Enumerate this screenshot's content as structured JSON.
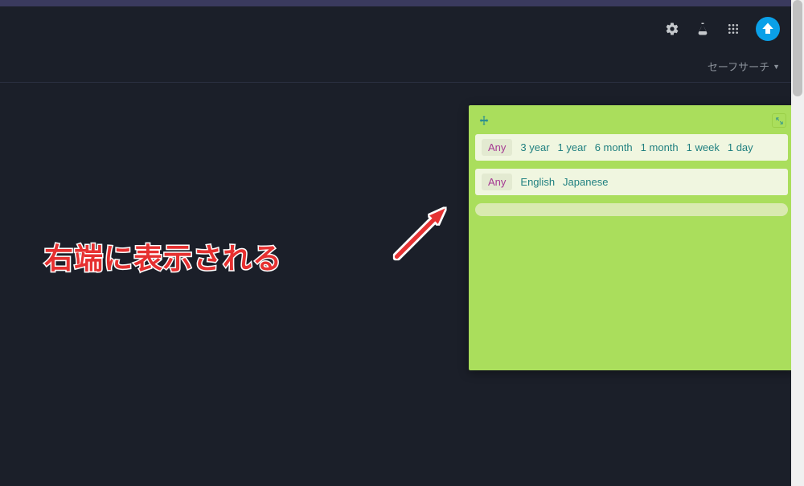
{
  "header": {
    "icons": {
      "settings": "gear",
      "labs": "beaker",
      "apps": "grid"
    }
  },
  "subheader": {
    "safesearch_label": "セーフサーチ"
  },
  "panel": {
    "time_row": {
      "any": "Any",
      "options": [
        "3 year",
        "1 year",
        "6 month",
        "1 month",
        "1 week",
        "1 day"
      ]
    },
    "lang_row": {
      "any": "Any",
      "options": [
        "English",
        "Japanese"
      ]
    }
  },
  "annotation": {
    "text": "右端に表示される"
  }
}
